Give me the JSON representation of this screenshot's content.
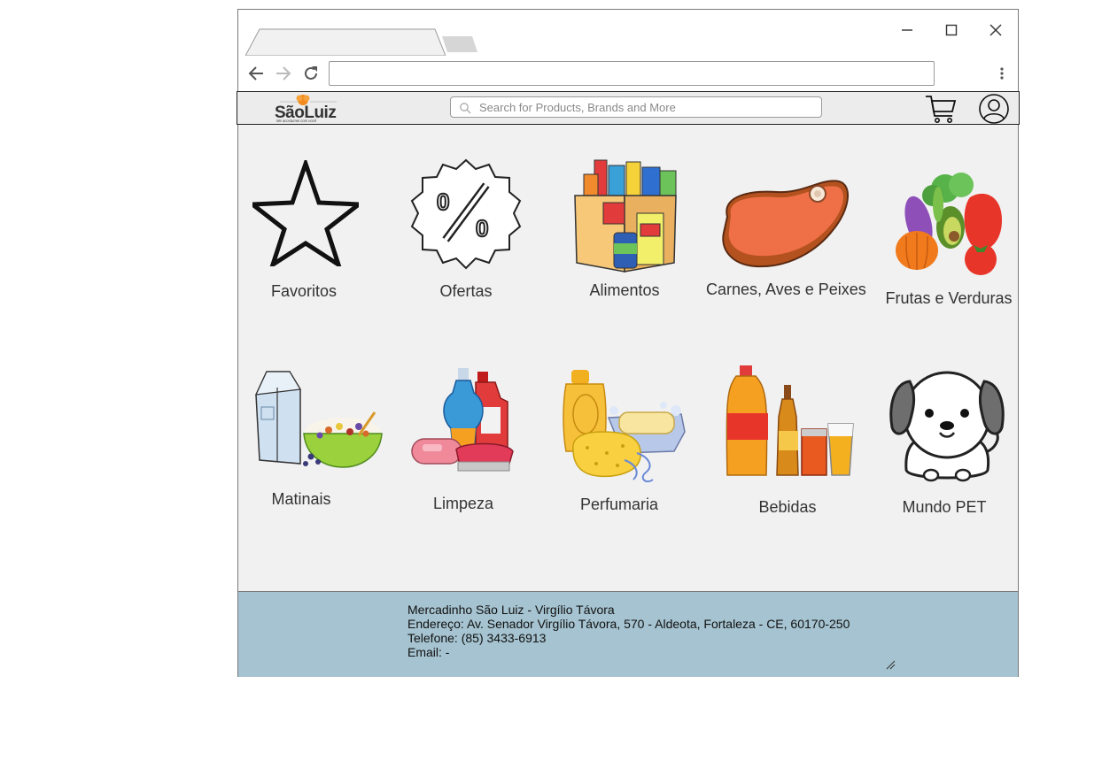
{
  "browser": {
    "url": "",
    "menu_icon": "kebab-icon"
  },
  "header": {
    "logo_text": "SãoLuiz",
    "logo_tagline": "Me acostumei com você",
    "search_placeholder": "Search for Products, Brands and More",
    "cart_icon": "cart-icon",
    "user_icon": "user-icon"
  },
  "categories": [
    {
      "label": "Favoritos",
      "icon": "star-icon"
    },
    {
      "label": "Ofertas",
      "icon": "percent-badge-icon"
    },
    {
      "label": "Alimentos",
      "icon": "groceries-box-icon"
    },
    {
      "label": "Carnes, Aves e Peixes",
      "icon": "steak-icon"
    },
    {
      "label": "Frutas e Verduras",
      "icon": "vegetables-icon"
    },
    {
      "label": "Matinais",
      "icon": "milk-cereal-icon"
    },
    {
      "label": "Limpeza",
      "icon": "cleaning-products-icon"
    },
    {
      "label": "Perfumaria",
      "icon": "soap-sponge-icon"
    },
    {
      "label": "Bebidas",
      "icon": "drinks-icon"
    },
    {
      "label": "Mundo PET",
      "icon": "dog-icon"
    }
  ],
  "footer": {
    "line1": "Mercadinho São Luiz - Virgílio Távora",
    "line2": "Endereço: Av. Senador Virgílio Távora, 570 - Aldeota, Fortaleza - CE, 60170-250",
    "line3": "Telefone: (85) 3433-6913",
    "line4": "Email: -"
  },
  "colors": {
    "footer_bg": "#a5c3d0",
    "page_bg": "#f1f1f1",
    "header_bg": "#ececec"
  }
}
